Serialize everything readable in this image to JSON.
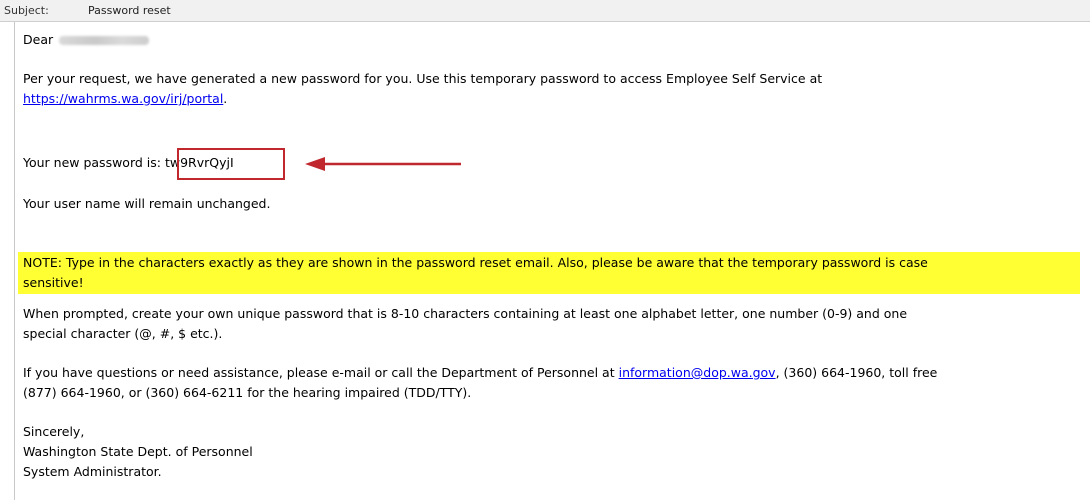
{
  "header": {
    "subject_label": "Subject:",
    "subject_value": "Password reset"
  },
  "email": {
    "greeting": "Dear",
    "para1_line1": "Per your request, we have generated a new password for you. Use this temporary password to access Employee Self Service at",
    "portal_link": "https://wahrms.wa.gov/irj/portal",
    "portal_suffix": ".",
    "password_prefix": "Your new password is",
    "password_value": ": tw9RvrQyjI",
    "username_line": "Your user name will remain unchanged.",
    "note_line1": "NOTE:  Type in the characters exactly as they are shown in the password reset email. Also, please be aware that the temporary password is case",
    "note_line2": "sensitive!",
    "prompt_line1": "When prompted, create your own unique password that is 8-10 characters containing at least one alphabet letter, one number (0-9) and one",
    "prompt_line2": "special character (@, #, $ etc.).",
    "contact_prefix": "If you have questions or need assistance, please e-mail or call the Department of Personnel at",
    "contact_email": "information@dop.wa.gov",
    "contact_suffix": ", (360) 664-1960, toll free",
    "contact_line2": "(877) 664-1960, or (360) 664-6211 for the hearing impaired (TDD/TTY).",
    "closing": "Sincerely,",
    "signature1": "Washington State Dept. of Personnel",
    "signature2": "System Administrator."
  },
  "colors": {
    "highlight": "#ffff33",
    "annotation": "#c0282d",
    "link": "#0000ee"
  },
  "icons": {
    "annotation": "arrow-left-icon"
  }
}
